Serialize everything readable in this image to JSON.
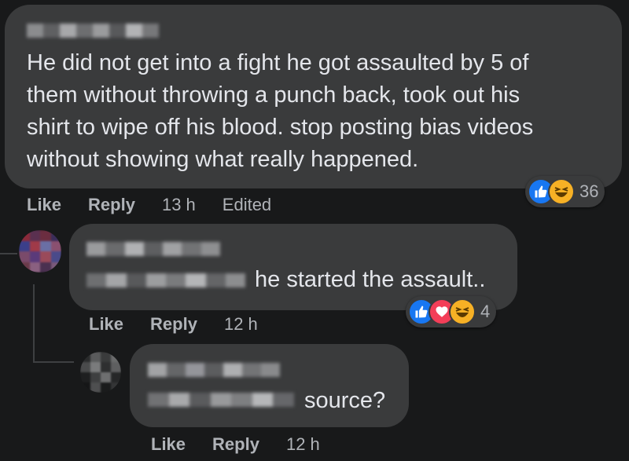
{
  "comments": [
    {
      "text_lines": [
        "He did not get into a fight he got assaulted by 5 of",
        "them without throwing a punch back, took out his",
        "shirt to wipe off his blood. stop posting bias videos",
        "without showing what really happened."
      ],
      "actions": {
        "like": "Like",
        "reply": "Reply",
        "time": "13 h",
        "edited": "Edited"
      },
      "reactions": {
        "icons": [
          "like-icon",
          "haha-icon"
        ],
        "count": "36"
      }
    },
    {
      "text": "he started the assault..",
      "actions": {
        "like": "Like",
        "reply": "Reply",
        "time": "12 h"
      },
      "reactions": {
        "icons": [
          "like-icon",
          "love-icon",
          "haha-icon"
        ],
        "count": "4"
      }
    },
    {
      "text": "source?",
      "actions": {
        "like": "Like",
        "reply": "Reply",
        "time": "12 h"
      }
    }
  ],
  "colors": {
    "background": "#18191a",
    "bubble": "#3a3b3c",
    "text": "#e4e6eb",
    "secondary_text": "#b0b3b8",
    "like_blue": "#1877f2",
    "love_red": "#f33e58",
    "haha_yellow": "#f7b125"
  }
}
